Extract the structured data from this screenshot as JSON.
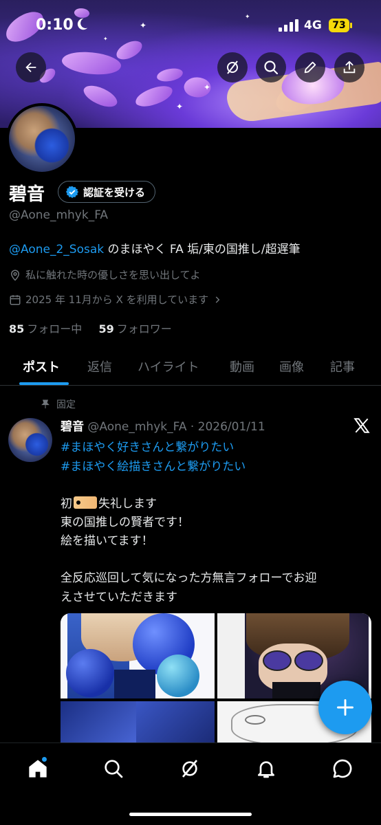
{
  "status_bar": {
    "time": "0:10",
    "network": "4G",
    "battery": "73"
  },
  "profile": {
    "name": "碧音",
    "verify_label": "認証を受ける",
    "handle": "@Aone_mhyk_FA",
    "bio_mention": "@Aone_2_Sosak",
    "bio_text": "のまほやく FA 垢/東の国推し/超遅筆",
    "location": "私に触れた時の優しさを思い出してよ",
    "joined": "2025 年 11月から X を利用しています",
    "following_count": "85",
    "following_label": "フォロー中",
    "followers_count": "59",
    "followers_label": "フォロワー"
  },
  "tabs": [
    {
      "label": "ポスト",
      "active": true
    },
    {
      "label": "返信"
    },
    {
      "label": "ハイライト"
    },
    {
      "label": "動画"
    },
    {
      "label": "画像"
    },
    {
      "label": "記事"
    }
  ],
  "pinned_post": {
    "pinned_label": "固定",
    "author_name": "碧音",
    "author_meta": "@Aone_mhyk_FA · 2026/01/11",
    "hashtags": [
      "#まほやく好きさんと繋がりたい",
      "#まほやく絵描きさんと繋がりたい"
    ],
    "lines": [
      {
        "prefix": "初",
        "suffix": "失礼します"
      },
      {
        "text": "東の国推しの賢者です！"
      },
      {
        "text": "絵を描いてます！"
      },
      {
        "text": "全反応巡回して気になった方無言フォローでお迎"
      },
      {
        "text": "えさせていただきます"
      }
    ]
  },
  "icons": {
    "back": "arrow-left-icon",
    "grok": "grok-icon",
    "search": "search-icon",
    "edit": "pen-icon",
    "share": "share-icon",
    "verified": "verified-badge-icon",
    "location": "location-pin-icon",
    "calendar": "calendar-icon",
    "pin": "pin-icon",
    "x_logo": "x-logo-icon",
    "fab": "plus-icon",
    "home": "home-icon",
    "explore": "search-icon",
    "grok_nav": "grok-icon",
    "notifications": "bell-icon",
    "messages": "message-icon"
  },
  "colors": {
    "accent": "#1d9bf0",
    "background": "#000000",
    "muted": "#71767b",
    "battery": "#f5d90a"
  }
}
